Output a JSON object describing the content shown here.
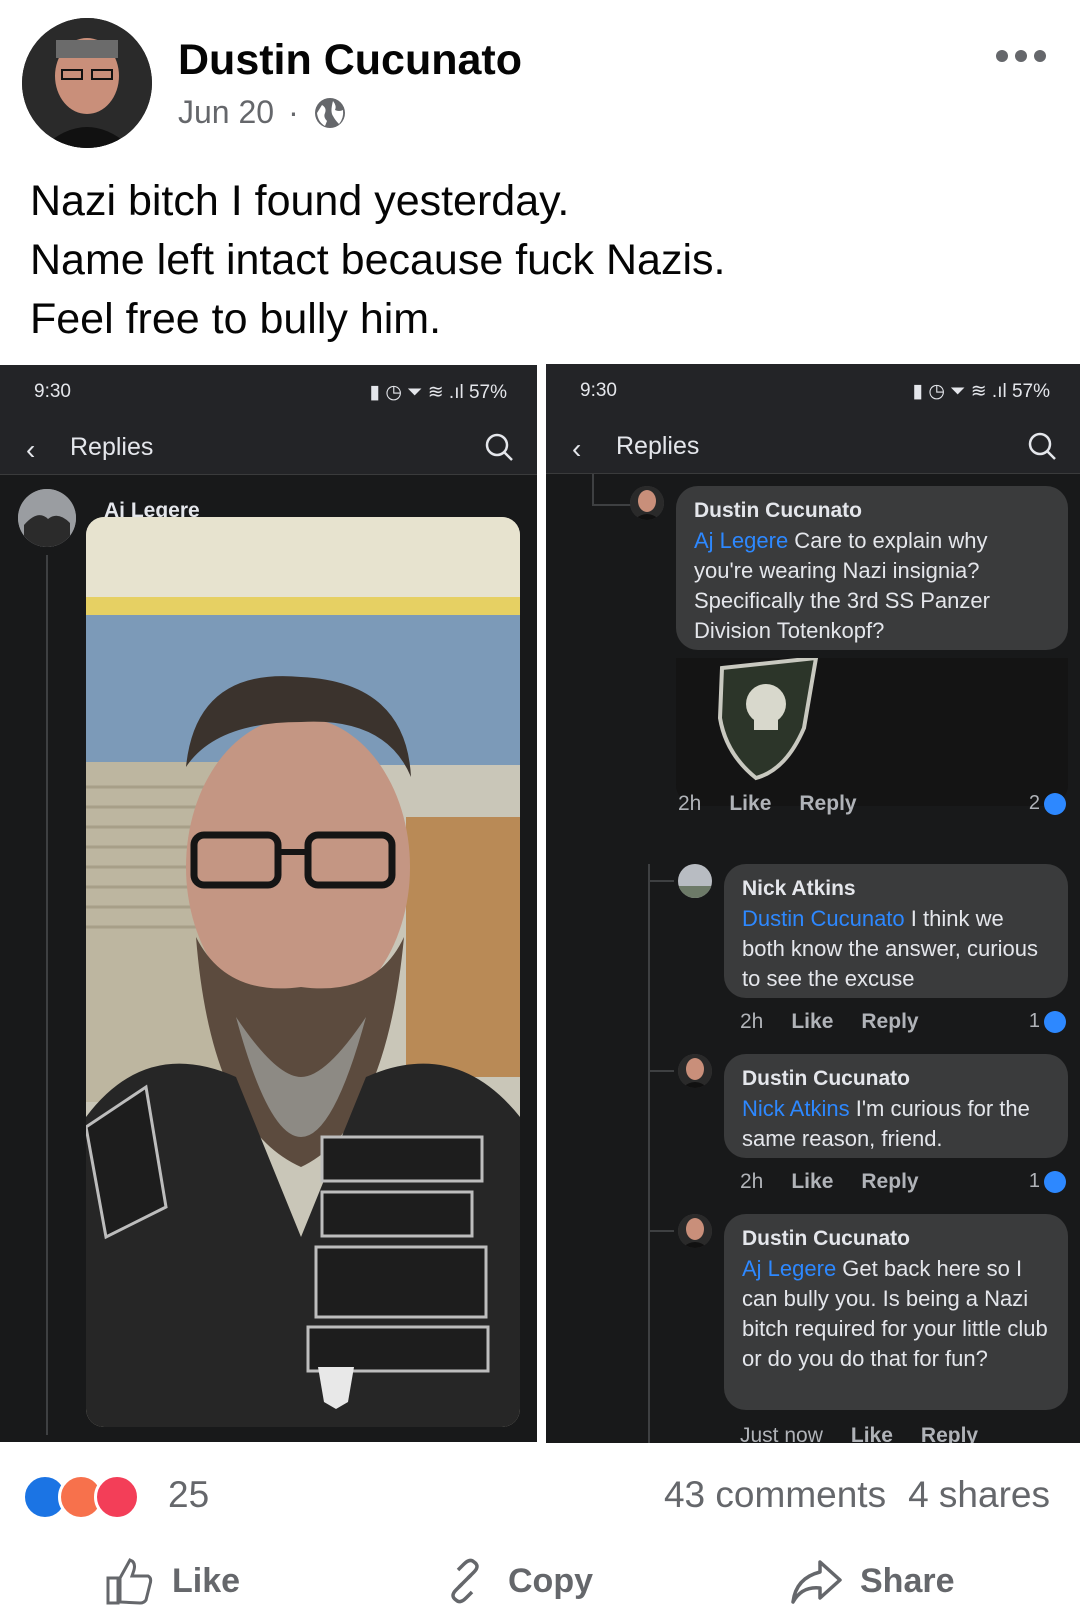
{
  "post": {
    "author": "Dustin Cucunato",
    "date": "Jun 20",
    "dot": "·",
    "privacy_icon": "globe-icon",
    "text_lines": [
      "Nazi bitch I found yesterday.",
      "Name left intact because fuck Nazis.",
      "Feel free to bully him."
    ]
  },
  "left_shot": {
    "time": "9:30",
    "battery": "57%",
    "header_title": "Replies",
    "commenter": "Aj Legere"
  },
  "right_shot": {
    "time": "9:30",
    "battery": "57%",
    "header_title": "Replies",
    "comments": [
      {
        "name": "Dustin Cucunato",
        "mention": "Aj Legere",
        "text": " Care to explain why you're wearing Nazi insignia? Specifically the 3rd SS Panzer Division Totenkopf?",
        "time": "2h",
        "like": "Like",
        "reply": "Reply",
        "likes": "2"
      },
      {
        "name": "Nick Atkins",
        "mention": "Dustin Cucunato",
        "text": " I think we both know the answer, curious to see the excuse",
        "time": "2h",
        "like": "Like",
        "reply": "Reply",
        "likes": "1"
      },
      {
        "name": "Dustin Cucunato",
        "mention": "Nick Atkins",
        "text": " I'm curious for the same reason, friend.",
        "time": "2h",
        "like": "Like",
        "reply": "Reply",
        "likes": "1"
      },
      {
        "name": "Dustin Cucunato",
        "mention": "Aj Legere",
        "text": " Get back here so I can bully you. Is being a Nazi bitch required for your little club or do you do that for fun?",
        "time": "Just now",
        "like": "Like",
        "reply": "Reply"
      }
    ]
  },
  "footer": {
    "reaction_count": "25",
    "comments": "43 comments",
    "shares": "4 shares",
    "like_label": "Like",
    "copy_label": "Copy",
    "share_label": "Share"
  },
  "colors": {
    "accent": "#2d88ff",
    "like_blue": "#1b74e4",
    "angry": "#f7714c",
    "love": "#f33e58",
    "dark_bg": "#18191a",
    "bubble": "#3a3b3c"
  }
}
